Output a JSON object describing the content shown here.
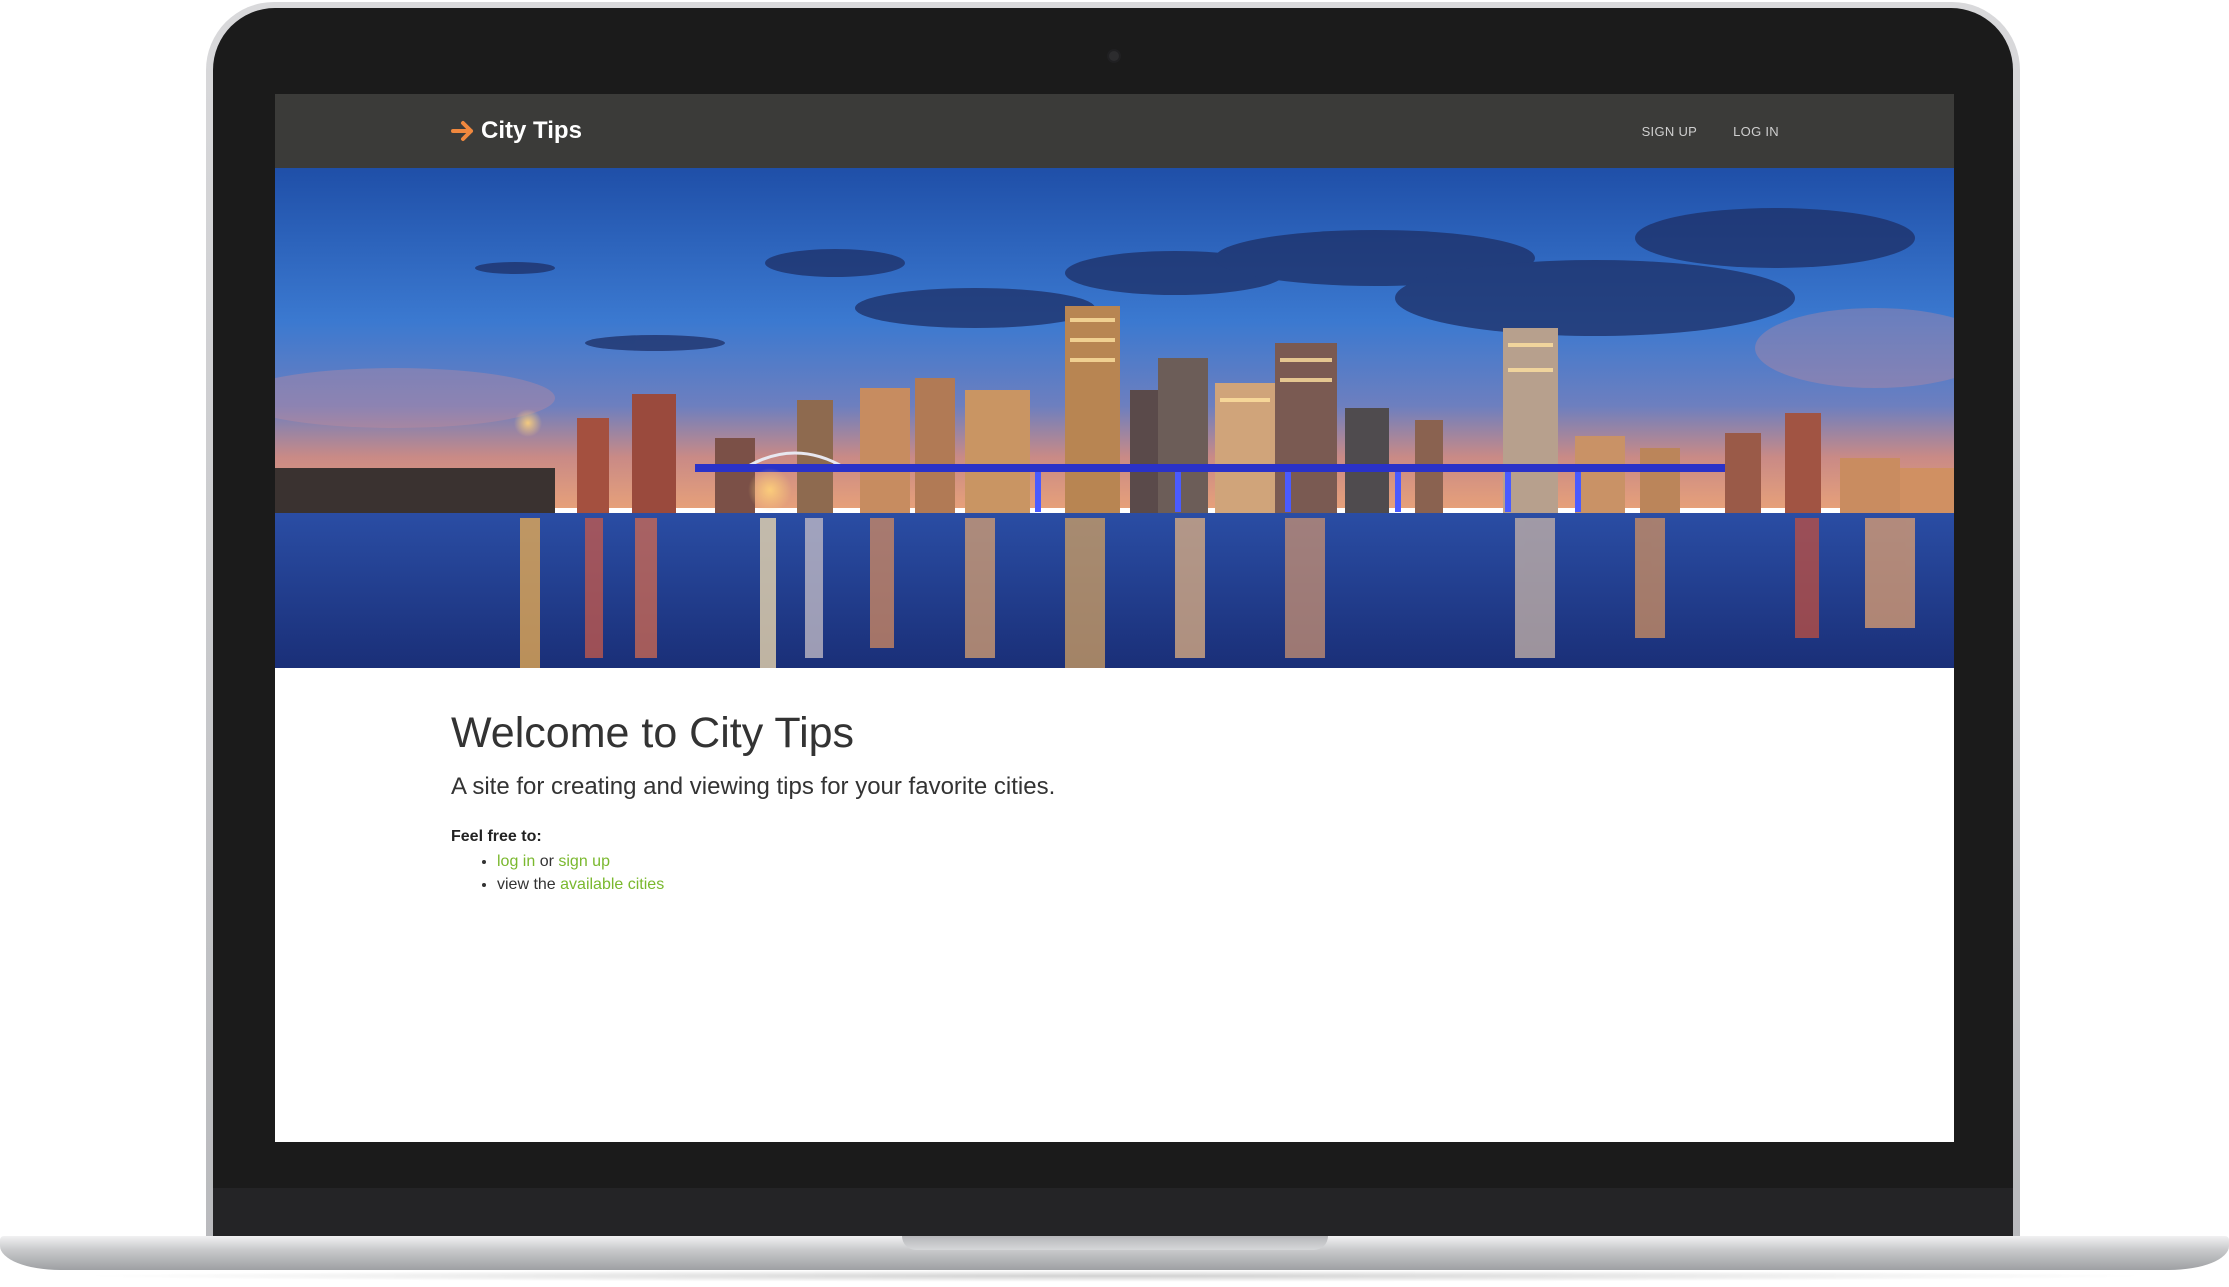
{
  "brand": {
    "name": "City Tips",
    "accent_color": "#f0883e",
    "icon": "arrow-right-icon"
  },
  "nav": {
    "sign_up": "SIGN UP",
    "log_in": "LOG IN"
  },
  "hero": {
    "image": "city-skyline-at-night"
  },
  "main": {
    "title": "Welcome to City Tips",
    "subtitle": "A site for creating and viewing tips for your favorite cities.",
    "feel_free": "Feel free to:",
    "item1": {
      "link_login": "log in",
      "connector": " or ",
      "link_signup": "sign up"
    },
    "item2": {
      "prefix": "view the ",
      "link_cities": "available cities"
    }
  },
  "colors": {
    "navbar": "#3b3b39",
    "link": "#7ab82e",
    "text": "#333333"
  }
}
